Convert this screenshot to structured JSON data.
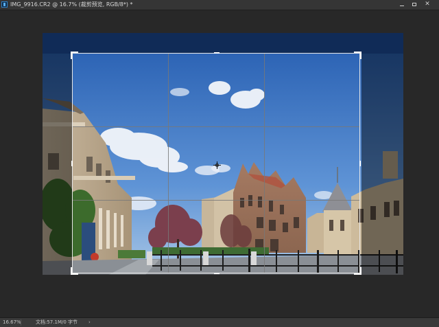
{
  "document": {
    "title": "IMG_9916.CR2 @ 16.7% (裁剪预览, RGB/8*) *"
  },
  "window_controls": {
    "minimize": "minimize",
    "maximize": "maximize",
    "close": "✕"
  },
  "tool": {
    "name": "crop",
    "grid": "rule-of-thirds"
  },
  "status": {
    "zoom": "16.67%",
    "doc_info": "文档:57.1M/0 字节",
    "arrow": "›"
  },
  "colors": {
    "workspace": "#282828",
    "panel": "#353535",
    "sky": "#4a7fc4"
  }
}
